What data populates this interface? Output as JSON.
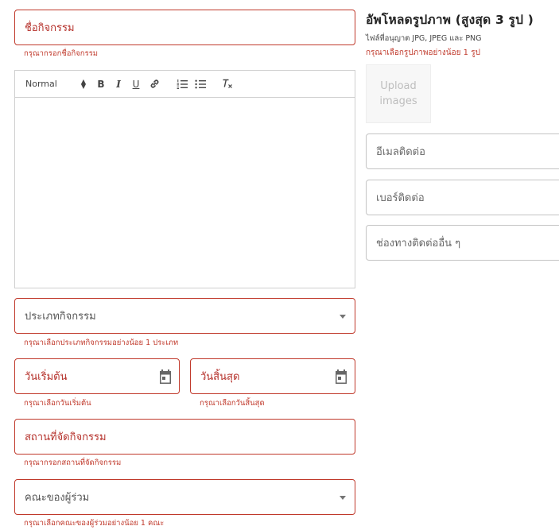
{
  "form": {
    "activity_name": {
      "label": "ชื่อกิจกรรม",
      "error": "กรุณากรอกชื่อกิจกรรม"
    },
    "editor": {
      "heading_select": "Normal",
      "tools": [
        "bold-icon",
        "italic-icon",
        "underline-icon",
        "link-icon",
        "ordered-list-icon",
        "bullet-list-icon",
        "clear-format-icon"
      ]
    },
    "activity_type": {
      "label": "ประเภทกิจกรรม",
      "error": "กรุณาเลือกประเภทกิจกรรมอย่างน้อย 1 ประเภท"
    },
    "start_date": {
      "label": "วันเริ่มต้น",
      "error": "กรุณาเลือกวันเริ่มต้น"
    },
    "end_date": {
      "label": "วันสิ้นสุด",
      "error": "กรุณาเลือกวันสิ้นสุด"
    },
    "venue": {
      "label": "สถานที่จัดกิจกรรม",
      "error": "กรุณากรอกสถานที่จัดกิจกรรม"
    },
    "faculty": {
      "label": "คณะของผู้ร่วม",
      "error": "กรุณาเลือกคณะของผู้ร่วมอย่างน้อย 1 คณะ"
    }
  },
  "upload": {
    "title": "อัพโหลดรูปภาพ (สูงสุด 3 รูป )",
    "note": "ไฟล์ที่อนุญาต JPG, JPEG และ PNG",
    "error": "กรุณาเลือกรูปภาพอย่างน้อย 1 รูป",
    "button_line1": "Upload",
    "button_line2": "images"
  },
  "contact": {
    "email": "อีเมลติดต่อ",
    "phone": "เบอร์ติดต่อ",
    "other": "ช่องทางติดต่ออื่น ๆ"
  },
  "colors": {
    "error": "#c0392b",
    "border_neutral": "#c4c4c4"
  }
}
